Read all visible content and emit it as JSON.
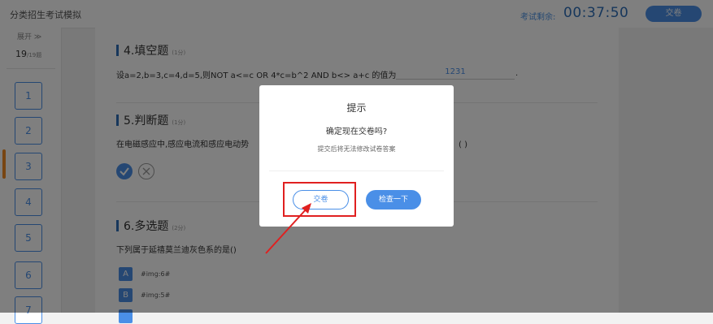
{
  "header": {
    "app_title": "分类招生考试模拟",
    "timer_label": "考试剩余:",
    "timer_value": "00:37:50",
    "submit_label": "交卷"
  },
  "sidebar": {
    "expand_label": "展开 ≫",
    "progress_current": "19",
    "progress_total": "/19题",
    "questions": [
      "1",
      "2",
      "3",
      "4",
      "5",
      "6",
      "7"
    ]
  },
  "q4": {
    "title": "4.填空题",
    "points": "(1分)",
    "text": "设a=2,b=3,c=4,d=5,则NOT  a<=c  OR  4*c=b^2  AND  b<>  a+c  的值为",
    "answer": "1231",
    "end": "."
  },
  "q5": {
    "title": "5.判断题",
    "points": "(1分)",
    "text": "在电磁感应中,感应电流和感应电动势",
    "end": "。( )"
  },
  "q6": {
    "title": "6.多选题",
    "points": "(2分)",
    "text": "下列属于延禧莫兰迪灰色系的是()",
    "options": [
      {
        "letter": "A",
        "text": "#img:6#"
      },
      {
        "letter": "B",
        "text": "#img:5#"
      }
    ]
  },
  "modal": {
    "title": "提示",
    "message": "确定现在交卷吗?",
    "sub": "提交后将无法修改试卷答案",
    "submit_label": "交卷",
    "check_label": "检查一下"
  },
  "colors": {
    "accent": "#4a8fe7",
    "highlight": "#e02020",
    "current": "#f08a24"
  }
}
